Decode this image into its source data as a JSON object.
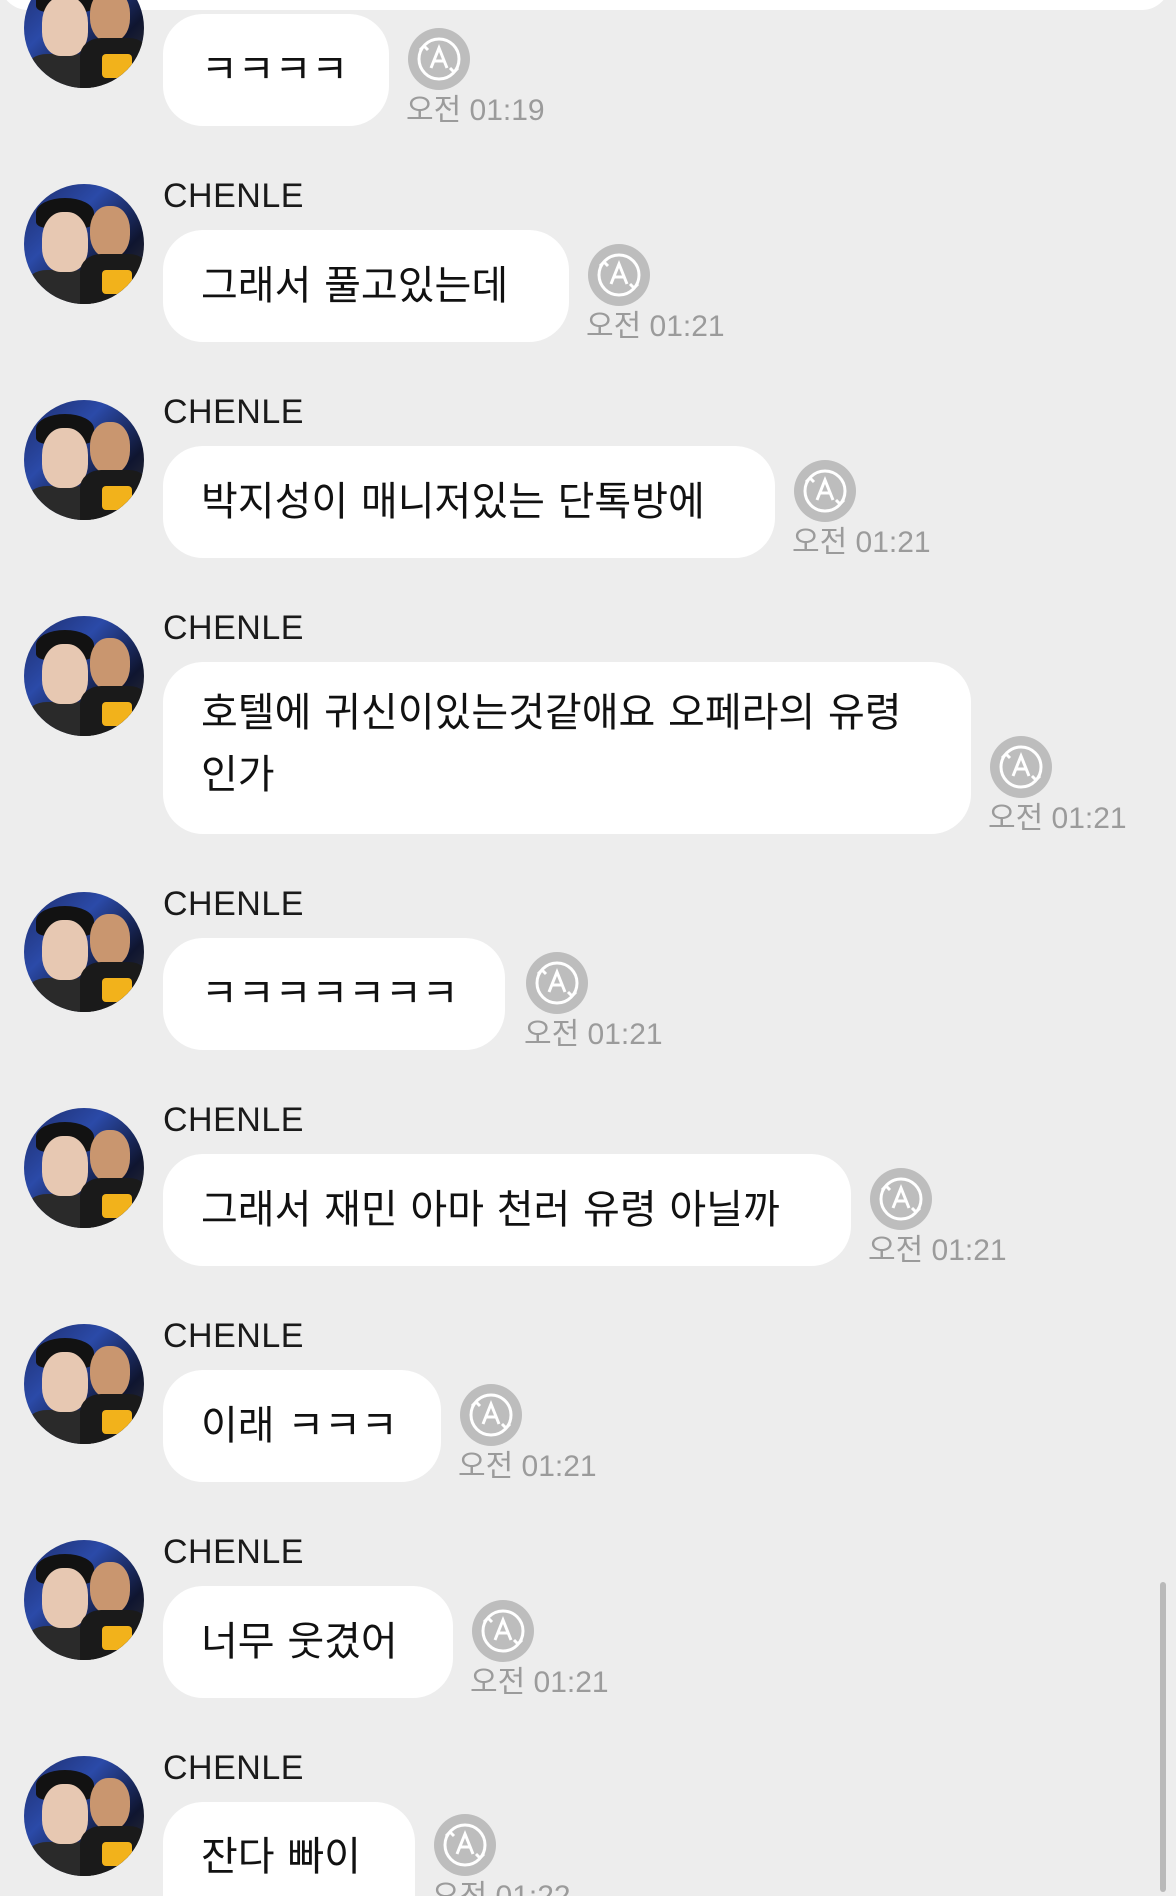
{
  "chat": {
    "messages": [
      {
        "sender": "",
        "text": "ㅋㅋㅋㅋ",
        "time": "오전 01:19"
      },
      {
        "sender": "CHENLE",
        "text": "그래서 풀고있는데",
        "time": "오전 01:21"
      },
      {
        "sender": "CHENLE",
        "text": "박지성이 매니저있는 단톡방에",
        "time": "오전 01:21"
      },
      {
        "sender": "CHENLE",
        "text": "호텔에 귀신이있는것같애요 오페라의 유령 인가",
        "time": "오전 01:21"
      },
      {
        "sender": "CHENLE",
        "text": "ㅋㅋㅋㅋㅋㅋㅋ",
        "time": "오전 01:21"
      },
      {
        "sender": "CHENLE",
        "text": "그래서 재민 아마 천러 유령 아닐까",
        "time": "오전 01:21"
      },
      {
        "sender": "CHENLE",
        "text": "이래 ㅋㅋㅋ",
        "time": "오전 01:21"
      },
      {
        "sender": "CHENLE",
        "text": "너무 웃겼어",
        "time": "오전 01:21"
      },
      {
        "sender": "CHENLE",
        "text": "잔다 빠이",
        "time": "오전 01:22"
      }
    ]
  },
  "icons": {
    "translate": "translate-icon",
    "avatar": "profile-photo"
  },
  "colors": {
    "background": "#ededed",
    "bubble": "#ffffff",
    "time_text": "#9b9b9b",
    "icon": "#bdbdbd"
  }
}
